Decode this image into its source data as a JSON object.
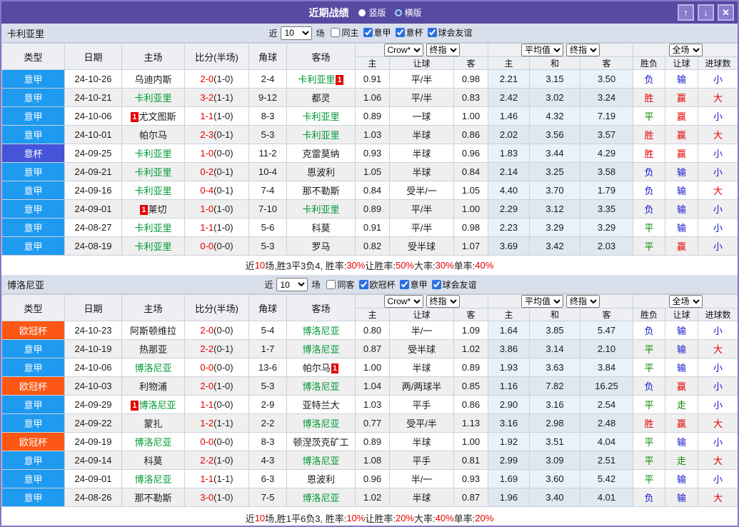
{
  "titlebar": {
    "title": "近期战绩",
    "radios": [
      {
        "label": "竖版",
        "selected": true
      },
      {
        "label": "横版",
        "selected": false
      }
    ],
    "buttons": {
      "up": "↑",
      "down": "↓",
      "close": "✕"
    }
  },
  "table_header": {
    "main_columns": [
      "类型",
      "日期",
      "主场",
      "比分(半场)",
      "角球",
      "客场"
    ],
    "selects": [
      "Crow*",
      "终指",
      "平均值",
      "终指",
      "全场"
    ],
    "sub": [
      "主",
      "让球",
      "客",
      "主",
      "和",
      "客",
      "胜负",
      "让球",
      "进球数"
    ]
  },
  "league_colors": {
    "意甲": "#1e9af0",
    "意杯": "#4554d8",
    "欧冠杯": "#fc5714"
  },
  "result_colors": {
    "red": "#e60000",
    "green": "#008a00",
    "blue": "#1616d1"
  },
  "sections": [
    {
      "team": "卡利亚里",
      "filter": {
        "near_label": "近",
        "count": "10",
        "games_label": "场",
        "checkboxes": [
          {
            "label": "同主",
            "checked": false
          },
          {
            "label": "意甲",
            "checked": true
          },
          {
            "label": "意杯",
            "checked": true
          },
          {
            "label": "球会友谊",
            "checked": true
          }
        ]
      },
      "rows": [
        {
          "league": "意甲",
          "date": "24-10-26",
          "home": {
            "name": "乌迪内斯"
          },
          "score": "2-0",
          "half": "(1-0)",
          "corners": "2-4",
          "away": {
            "name": "卡利亚里",
            "focal": true,
            "card_after": true
          },
          "odds": [
            "0.91",
            "平/半",
            "0.98"
          ],
          "avg": [
            "2.21",
            "3.15",
            "3.50"
          ],
          "results": [
            {
              "text": "负",
              "color": "blue"
            },
            {
              "text": "输",
              "color": "blue"
            },
            {
              "text": "小",
              "color": "blue"
            }
          ]
        },
        {
          "league": "意甲",
          "date": "24-10-21",
          "home": {
            "name": "卡利亚里",
            "focal": true
          },
          "score": "3-2",
          "half": "(1-1)",
          "corners": "9-12",
          "away": {
            "name": "都灵"
          },
          "odds": [
            "1.06",
            "平/半",
            "0.83"
          ],
          "avg": [
            "2.42",
            "3.02",
            "3.24"
          ],
          "results": [
            {
              "text": "胜",
              "color": "red"
            },
            {
              "text": "赢",
              "color": "red"
            },
            {
              "text": "大",
              "color": "red"
            }
          ]
        },
        {
          "league": "意甲",
          "date": "24-10-06",
          "home": {
            "name": "尤文图斯",
            "card_before": true
          },
          "score": "1-1",
          "half": "(1-0)",
          "corners": "8-3",
          "away": {
            "name": "卡利亚里",
            "focal": true
          },
          "odds": [
            "0.89",
            "一球",
            "1.00"
          ],
          "avg": [
            "1.46",
            "4.32",
            "7.19"
          ],
          "results": [
            {
              "text": "平",
              "color": "green"
            },
            {
              "text": "赢",
              "color": "red"
            },
            {
              "text": "小",
              "color": "blue"
            }
          ]
        },
        {
          "league": "意甲",
          "date": "24-10-01",
          "home": {
            "name": "帕尔马"
          },
          "score": "2-3",
          "half": "(0-1)",
          "corners": "5-3",
          "away": {
            "name": "卡利亚里",
            "focal": true
          },
          "odds": [
            "1.03",
            "半球",
            "0.86"
          ],
          "avg": [
            "2.02",
            "3.56",
            "3.57"
          ],
          "results": [
            {
              "text": "胜",
              "color": "red"
            },
            {
              "text": "赢",
              "color": "red"
            },
            {
              "text": "大",
              "color": "red"
            }
          ]
        },
        {
          "league": "意杯",
          "date": "24-09-25",
          "home": {
            "name": "卡利亚里",
            "focal": true
          },
          "score": "1-0",
          "half": "(0-0)",
          "corners": "11-2",
          "away": {
            "name": "克雷莫纳"
          },
          "odds": [
            "0.93",
            "半球",
            "0.96"
          ],
          "avg": [
            "1.83",
            "3.44",
            "4.29"
          ],
          "results": [
            {
              "text": "胜",
              "color": "red"
            },
            {
              "text": "赢",
              "color": "red"
            },
            {
              "text": "小",
              "color": "blue"
            }
          ]
        },
        {
          "league": "意甲",
          "date": "24-09-21",
          "home": {
            "name": "卡利亚里",
            "focal": true
          },
          "score": "0-2",
          "half": "(0-1)",
          "corners": "10-4",
          "away": {
            "name": "恩波利"
          },
          "odds": [
            "1.05",
            "半球",
            "0.84"
          ],
          "avg": [
            "2.14",
            "3.25",
            "3.58"
          ],
          "results": [
            {
              "text": "负",
              "color": "blue"
            },
            {
              "text": "输",
              "color": "blue"
            },
            {
              "text": "小",
              "color": "blue"
            }
          ]
        },
        {
          "league": "意甲",
          "date": "24-09-16",
          "home": {
            "name": "卡利亚里",
            "focal": true
          },
          "score": "0-4",
          "half": "(0-1)",
          "corners": "7-4",
          "away": {
            "name": "那不勒斯"
          },
          "odds": [
            "0.84",
            "受半/一",
            "1.05"
          ],
          "avg": [
            "4.40",
            "3.70",
            "1.79"
          ],
          "results": [
            {
              "text": "负",
              "color": "blue"
            },
            {
              "text": "输",
              "color": "blue"
            },
            {
              "text": "大",
              "color": "red"
            }
          ]
        },
        {
          "league": "意甲",
          "date": "24-09-01",
          "home": {
            "name": "莱切",
            "card_before": true
          },
          "score": "1-0",
          "half": "(1-0)",
          "corners": "7-10",
          "away": {
            "name": "卡利亚里",
            "focal": true
          },
          "odds": [
            "0.89",
            "平/半",
            "1.00"
          ],
          "avg": [
            "2.29",
            "3.12",
            "3.35"
          ],
          "results": [
            {
              "text": "负",
              "color": "blue"
            },
            {
              "text": "输",
              "color": "blue"
            },
            {
              "text": "小",
              "color": "blue"
            }
          ]
        },
        {
          "league": "意甲",
          "date": "24-08-27",
          "home": {
            "name": "卡利亚里",
            "focal": true
          },
          "score": "1-1",
          "half": "(1-0)",
          "corners": "5-6",
          "away": {
            "name": "科莫"
          },
          "odds": [
            "0.91",
            "平/半",
            "0.98"
          ],
          "avg": [
            "2.23",
            "3.29",
            "3.29"
          ],
          "results": [
            {
              "text": "平",
              "color": "green"
            },
            {
              "text": "输",
              "color": "blue"
            },
            {
              "text": "小",
              "color": "blue"
            }
          ]
        },
        {
          "league": "意甲",
          "date": "24-08-19",
          "home": {
            "name": "卡利亚里",
            "focal": true
          },
          "score": "0-0",
          "half": "(0-0)",
          "corners": "5-3",
          "away": {
            "name": "罗马"
          },
          "odds": [
            "0.82",
            "受半球",
            "1.07"
          ],
          "avg": [
            "3.69",
            "3.42",
            "2.03"
          ],
          "results": [
            {
              "text": "平",
              "color": "green"
            },
            {
              "text": "赢",
              "color": "red"
            },
            {
              "text": "小",
              "color": "blue"
            }
          ]
        }
      ],
      "summary_segments": [
        {
          "text": "近",
          "red": false
        },
        {
          "text": "10",
          "red": true
        },
        {
          "text": "场,胜3平3负4, 胜率:",
          "red": false
        },
        {
          "text": "30%",
          "red": true
        },
        {
          "text": " 让胜率:",
          "red": false
        },
        {
          "text": "50%",
          "red": true
        },
        {
          "text": " 大率:",
          "red": false
        },
        {
          "text": "30%",
          "red": true
        },
        {
          "text": " 单率:",
          "red": false
        },
        {
          "text": "40%",
          "red": true
        }
      ]
    },
    {
      "team": "博洛尼亚",
      "filter": {
        "near_label": "近",
        "count": "10",
        "games_label": "场",
        "checkboxes": [
          {
            "label": "同客",
            "checked": false
          },
          {
            "label": "欧冠杯",
            "checked": true
          },
          {
            "label": "意甲",
            "checked": true
          },
          {
            "label": "球会友谊",
            "checked": true
          }
        ]
      },
      "rows": [
        {
          "league": "欧冠杯",
          "date": "24-10-23",
          "home": {
            "name": "阿斯顿维拉"
          },
          "score": "2-0",
          "half": "(0-0)",
          "corners": "5-4",
          "away": {
            "name": "博洛尼亚",
            "focal": true
          },
          "odds": [
            "0.80",
            "半/一",
            "1.09"
          ],
          "avg": [
            "1.64",
            "3.85",
            "5.47"
          ],
          "results": [
            {
              "text": "负",
              "color": "blue"
            },
            {
              "text": "输",
              "color": "blue"
            },
            {
              "text": "小",
              "color": "blue"
            }
          ]
        },
        {
          "league": "意甲",
          "date": "24-10-19",
          "home": {
            "name": "热那亚"
          },
          "score": "2-2",
          "half": "(0-1)",
          "corners": "1-7",
          "away": {
            "name": "博洛尼亚",
            "focal": true
          },
          "odds": [
            "0.87",
            "受半球",
            "1.02"
          ],
          "avg": [
            "3.86",
            "3.14",
            "2.10"
          ],
          "results": [
            {
              "text": "平",
              "color": "green"
            },
            {
              "text": "输",
              "color": "blue"
            },
            {
              "text": "大",
              "color": "red"
            }
          ]
        },
        {
          "league": "意甲",
          "date": "24-10-06",
          "home": {
            "name": "博洛尼亚",
            "focal": true
          },
          "score": "0-0",
          "half": "(0-0)",
          "corners": "13-6",
          "away": {
            "name": "帕尔马",
            "card_after": true
          },
          "odds": [
            "1.00",
            "半球",
            "0.89"
          ],
          "avg": [
            "1.93",
            "3.63",
            "3.84"
          ],
          "results": [
            {
              "text": "平",
              "color": "green"
            },
            {
              "text": "输",
              "color": "blue"
            },
            {
              "text": "小",
              "color": "blue"
            }
          ]
        },
        {
          "league": "欧冠杯",
          "date": "24-10-03",
          "home": {
            "name": "利物浦"
          },
          "score": "2-0",
          "half": "(1-0)",
          "corners": "5-3",
          "away": {
            "name": "博洛尼亚",
            "focal": true
          },
          "odds": [
            "1.04",
            "两/两球半",
            "0.85"
          ],
          "avg": [
            "1.16",
            "7.82",
            "16.25"
          ],
          "results": [
            {
              "text": "负",
              "color": "blue"
            },
            {
              "text": "赢",
              "color": "red"
            },
            {
              "text": "小",
              "color": "blue"
            }
          ]
        },
        {
          "league": "意甲",
          "date": "24-09-29",
          "home": {
            "name": "博洛尼亚",
            "focal": true,
            "card_before": true
          },
          "score": "1-1",
          "half": "(0-0)",
          "corners": "2-9",
          "away": {
            "name": "亚特兰大"
          },
          "odds": [
            "1.03",
            "平手",
            "0.86"
          ],
          "avg": [
            "2.90",
            "3.16",
            "2.54"
          ],
          "results": [
            {
              "text": "平",
              "color": "green"
            },
            {
              "text": "走",
              "color": "green"
            },
            {
              "text": "小",
              "color": "blue"
            }
          ]
        },
        {
          "league": "意甲",
          "date": "24-09-22",
          "home": {
            "name": "蒙扎"
          },
          "score": "1-2",
          "half": "(1-1)",
          "corners": "2-2",
          "away": {
            "name": "博洛尼亚",
            "focal": true
          },
          "odds": [
            "0.77",
            "受平/半",
            "1.13"
          ],
          "avg": [
            "3.16",
            "2.98",
            "2.48"
          ],
          "results": [
            {
              "text": "胜",
              "color": "red"
            },
            {
              "text": "赢",
              "color": "red"
            },
            {
              "text": "大",
              "color": "red"
            }
          ]
        },
        {
          "league": "欧冠杯",
          "date": "24-09-19",
          "home": {
            "name": "博洛尼亚",
            "focal": true
          },
          "score": "0-0",
          "half": "(0-0)",
          "corners": "8-3",
          "away": {
            "name": "顿涅茨克矿工"
          },
          "odds": [
            "0.89",
            "半球",
            "1.00"
          ],
          "avg": [
            "1.92",
            "3.51",
            "4.04"
          ],
          "results": [
            {
              "text": "平",
              "color": "green"
            },
            {
              "text": "输",
              "color": "blue"
            },
            {
              "text": "小",
              "color": "blue"
            }
          ]
        },
        {
          "league": "意甲",
          "date": "24-09-14",
          "home": {
            "name": "科莫"
          },
          "score": "2-2",
          "half": "(1-0)",
          "corners": "4-3",
          "away": {
            "name": "博洛尼亚",
            "focal": true
          },
          "odds": [
            "1.08",
            "平手",
            "0.81"
          ],
          "avg": [
            "2.99",
            "3.09",
            "2.51"
          ],
          "results": [
            {
              "text": "平",
              "color": "green"
            },
            {
              "text": "走",
              "color": "green"
            },
            {
              "text": "大",
              "color": "red"
            }
          ]
        },
        {
          "league": "意甲",
          "date": "24-09-01",
          "home": {
            "name": "博洛尼亚",
            "focal": true
          },
          "score": "1-1",
          "half": "(1-1)",
          "corners": "6-3",
          "away": {
            "name": "恩波利"
          },
          "odds": [
            "0.96",
            "半/一",
            "0.93"
          ],
          "avg": [
            "1.69",
            "3.60",
            "5.42"
          ],
          "results": [
            {
              "text": "平",
              "color": "green"
            },
            {
              "text": "输",
              "color": "blue"
            },
            {
              "text": "小",
              "color": "blue"
            }
          ]
        },
        {
          "league": "意甲",
          "date": "24-08-26",
          "home": {
            "name": "那不勒斯"
          },
          "score": "3-0",
          "half": "(1-0)",
          "corners": "7-5",
          "away": {
            "name": "博洛尼亚",
            "focal": true
          },
          "odds": [
            "1.02",
            "半球",
            "0.87"
          ],
          "avg": [
            "1.96",
            "3.40",
            "4.01"
          ],
          "results": [
            {
              "text": "负",
              "color": "blue"
            },
            {
              "text": "输",
              "color": "blue"
            },
            {
              "text": "大",
              "color": "red"
            }
          ]
        }
      ],
      "summary_segments": [
        {
          "text": "近",
          "red": false
        },
        {
          "text": "10",
          "red": true
        },
        {
          "text": "场,胜1平6负3, 胜率:",
          "red": false
        },
        {
          "text": "10%",
          "red": true
        },
        {
          "text": " 让胜率:",
          "red": false
        },
        {
          "text": "20%",
          "red": true
        },
        {
          "text": " 大率:",
          "red": false
        },
        {
          "text": "40%",
          "red": true
        },
        {
          "text": " 单率:",
          "red": false
        },
        {
          "text": "20%",
          "red": true
        }
      ]
    }
  ]
}
